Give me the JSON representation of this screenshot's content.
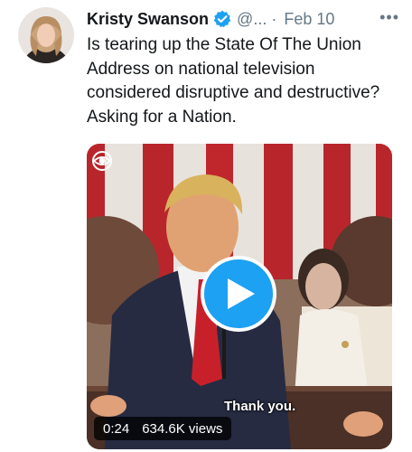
{
  "tweet": {
    "author_name": "Kristy Swanson",
    "handle": "@...",
    "separator": "·",
    "date": "Feb 10",
    "more_label": "•••",
    "text": "Is tearing up the State Of The Union Address on national television considered disruptive and destructive? Asking for a Nation.",
    "verified": true
  },
  "media": {
    "type": "video",
    "caption": "Thank you.",
    "duration": "0:24",
    "views": "634.6K views",
    "play_icon": "play-icon",
    "watermark_icon": "cbs-eye-icon"
  },
  "colors": {
    "accent": "#1da1f2",
    "text": "#14171a",
    "muted": "#657786"
  }
}
